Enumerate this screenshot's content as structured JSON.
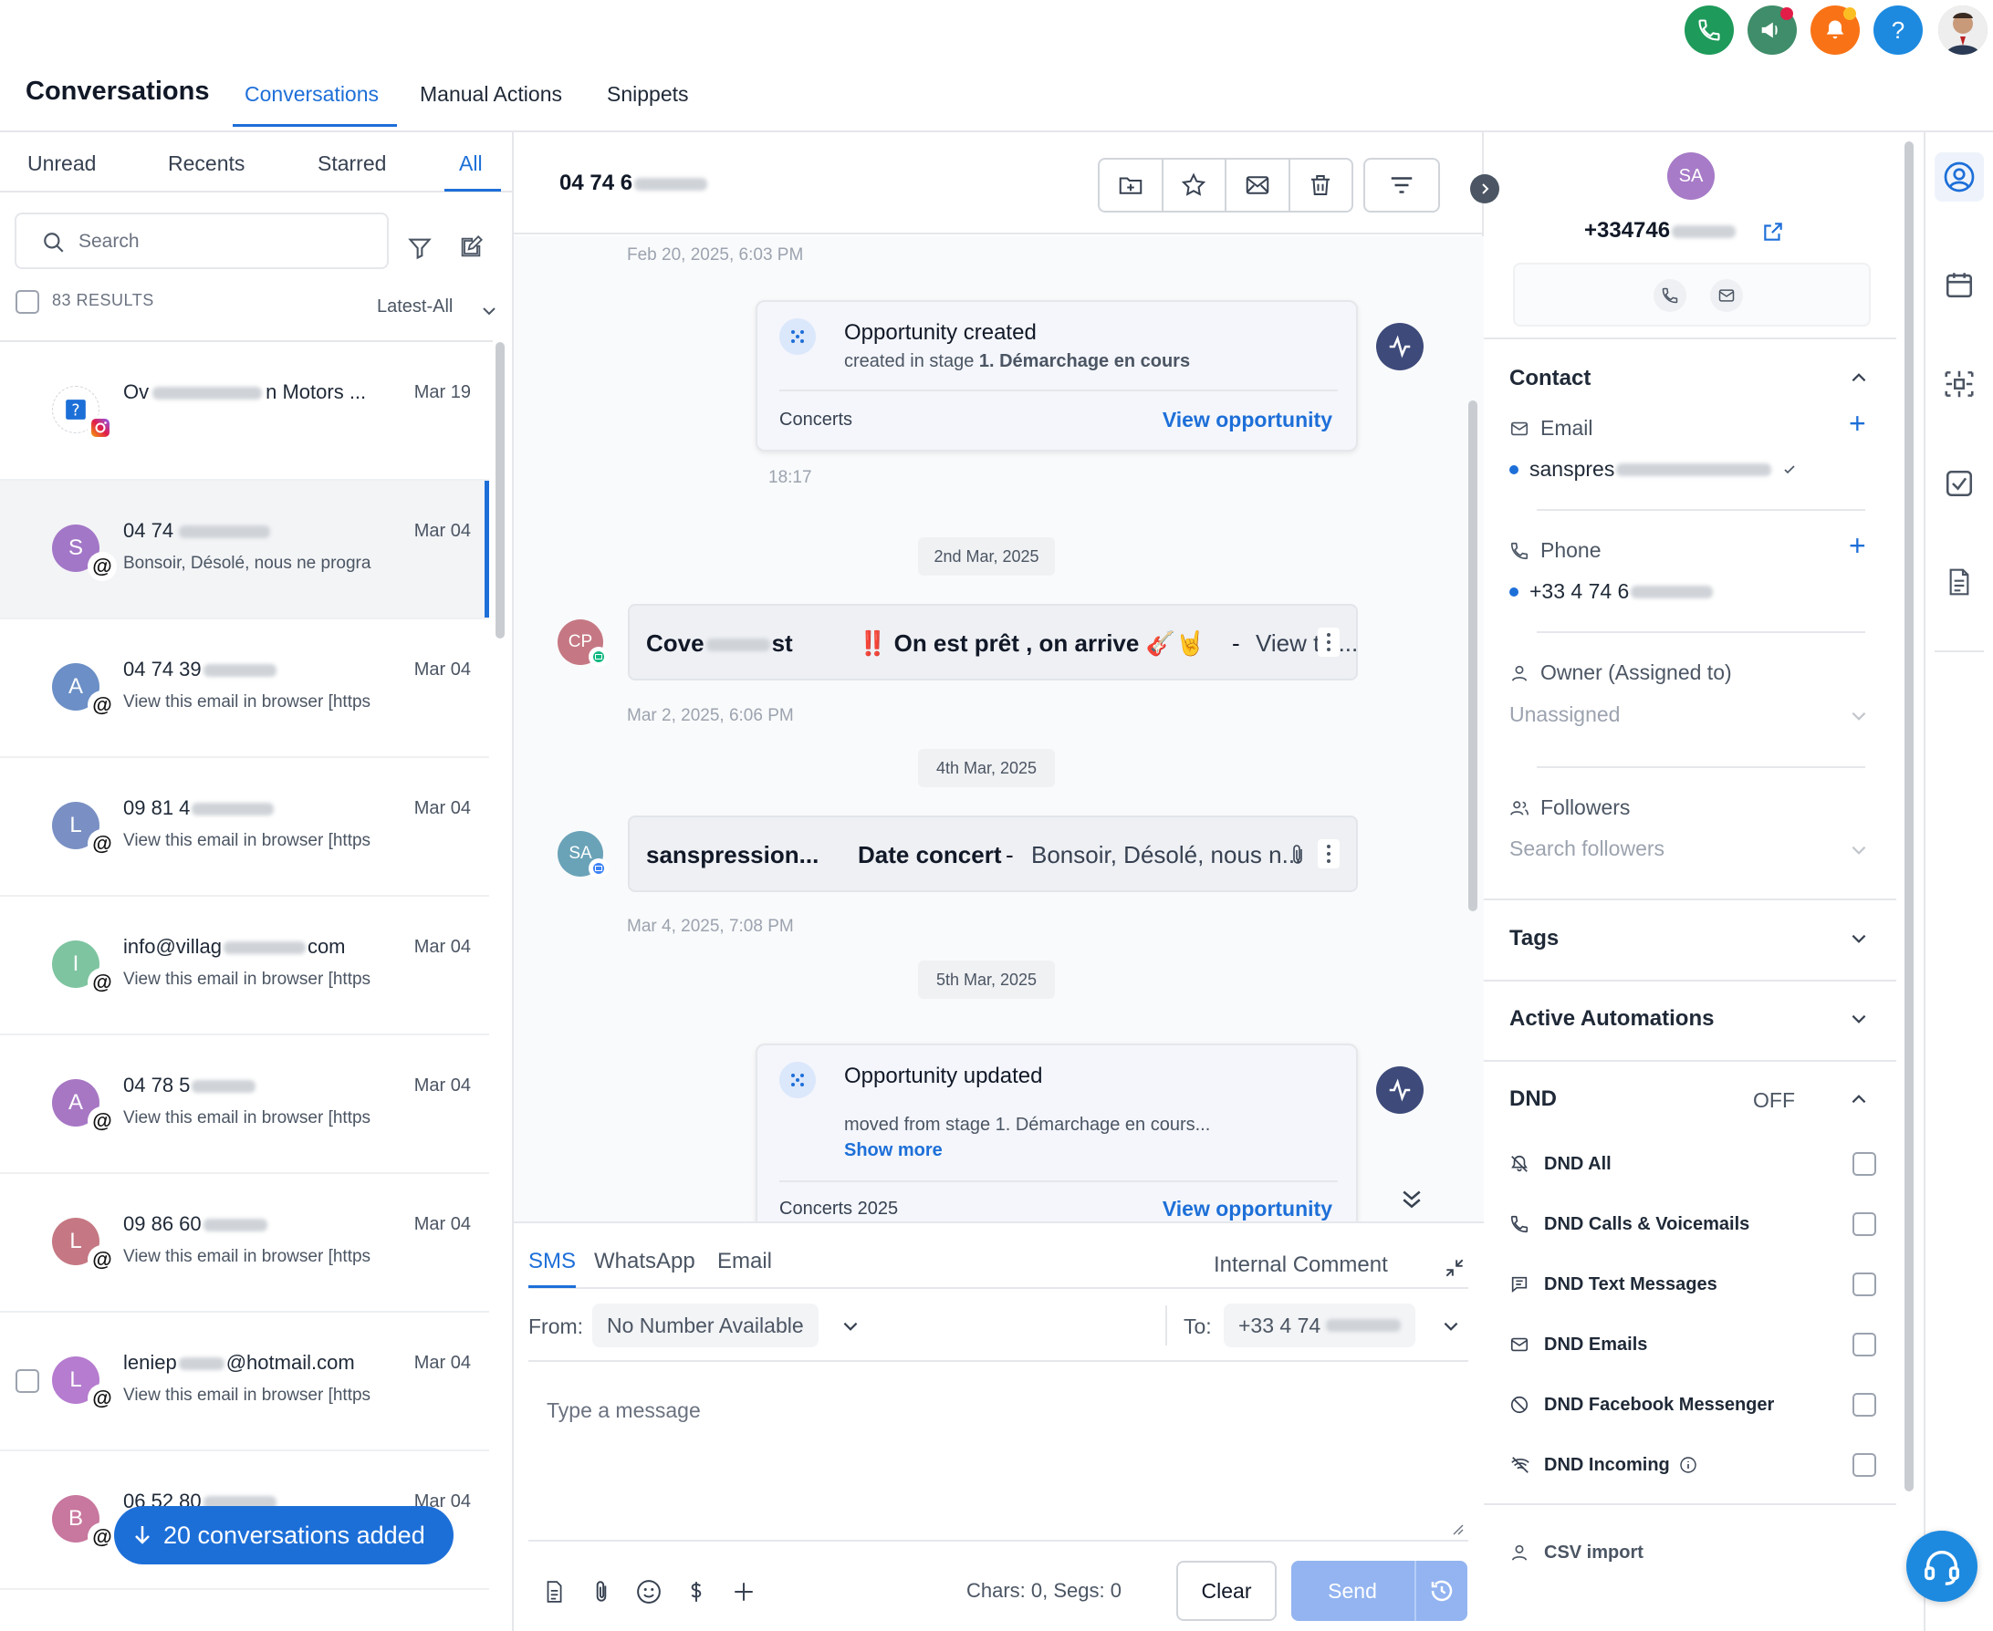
{
  "topbar": {
    "page_title": "Conversations",
    "tabs": [
      {
        "label": "Conversations",
        "active": true
      },
      {
        "label": "Manual Actions",
        "active": false
      },
      {
        "label": "Snippets",
        "active": false
      }
    ],
    "icons": [
      "phone-icon",
      "megaphone-icon",
      "bell-icon",
      "help-icon",
      "user-avatar"
    ],
    "help_label": "?"
  },
  "left": {
    "filter_tabs": [
      {
        "label": "Unread"
      },
      {
        "label": "Recents"
      },
      {
        "label": "Starred"
      },
      {
        "label": "All",
        "active": true
      }
    ],
    "search_placeholder": "Search",
    "results_label": "83 RESULTS",
    "sort_label": "Latest-All",
    "conversations": [
      {
        "name_start": "Ov",
        "name_end": "n Motors ...",
        "date": "Mar 19",
        "preview": "",
        "avatar": "",
        "color": "#ffffff"
      },
      {
        "name_start": "04 74",
        "name_end": "",
        "date": "Mar 04",
        "preview": "Bonsoir, Désolé, nous ne progra",
        "avatar": "S",
        "color": "#a377c7",
        "selected": true
      },
      {
        "name_start": "04 74 39",
        "name_end": "",
        "date": "Mar 04",
        "preview": "View this email in browser [https",
        "avatar": "A",
        "color": "#6b8fc6"
      },
      {
        "name_start": "09 81 4",
        "name_end": "",
        "date": "Mar 04",
        "preview": "View this email in browser [https",
        "avatar": "L",
        "color": "#7a90c4"
      },
      {
        "name_start": "info@villag",
        "name_end": "com",
        "date": "Mar 04",
        "preview": "View this email in browser [https",
        "avatar": "I",
        "color": "#7ec4a0"
      },
      {
        "name_start": "04 78 5",
        "name_end": "",
        "date": "Mar 04",
        "preview": "View this email in browser [https",
        "avatar": "A",
        "color": "#a777c4"
      },
      {
        "name_start": "09 86 60",
        "name_end": "",
        "date": "Mar 04",
        "preview": "View this email in browser [https",
        "avatar": "L",
        "color": "#c57883"
      },
      {
        "name_start": "leniep",
        "name_end": "@hotmail.com",
        "date": "Mar 04",
        "preview": "View this email in browser [https",
        "avatar": "L",
        "color": "#b57ccf"
      },
      {
        "name_start": "06 52 80",
        "name_end": "",
        "date": "Mar 04",
        "preview": "",
        "avatar": "B",
        "color": "#c8779e"
      }
    ],
    "toast": "20 conversations added"
  },
  "center": {
    "title": "04 74 6",
    "thread": {
      "ts1": "Feb 20, 2025, 6:03 PM",
      "opp1": {
        "title": "Opportunity created",
        "sub_prefix": "created in stage ",
        "sub_stage": "1. Démarchage en cours",
        "pipeline": "Concerts",
        "link": "View opportunity"
      },
      "time1": "18:17",
      "date1": "2nd Mar, 2025",
      "msg1": {
        "avatar": "CP",
        "from_start": "Cove",
        "from_end": "st",
        "subject": "‼️ On est prêt , on arrive 🎸🤘",
        "sep": "-",
        "snippet": "View thi..."
      },
      "ts2": "Mar 2, 2025, 6:06 PM",
      "date2": "4th Mar, 2025",
      "msg2": {
        "avatar": "SA",
        "from": "sanspression...",
        "subject": "Date concert",
        "sep": "-",
        "snippet": "Bonsoir, Désolé, nous n..."
      },
      "ts3": "Mar 4, 2025, 7:08 PM",
      "date3": "5th Mar, 2025",
      "opp2": {
        "title": "Opportunity updated",
        "sub": "moved from stage 1. Démarchage en cours...",
        "more": "Show more",
        "pipeline": "Concerts 2025",
        "link": "View opportunity"
      }
    },
    "composer": {
      "tabs": [
        {
          "label": "SMS",
          "active": true
        },
        {
          "label": "WhatsApp"
        },
        {
          "label": "Email"
        }
      ],
      "internal_comment": "Internal Comment",
      "from_label": "From:",
      "from_value": "No Number Available",
      "to_label": "To:",
      "to_value": "+33 4 74",
      "placeholder": "Type a message",
      "chars": "Chars: 0, Segs: 0",
      "clear": "Clear",
      "send": "Send"
    }
  },
  "right": {
    "avatar": "SA",
    "phone": "+334746",
    "contact": {
      "heading": "Contact",
      "email_label": "Email",
      "email_value": "sanspres",
      "phone_label": "Phone",
      "phone_value": "+33 4 74 6",
      "owner_label": "Owner (Assigned to)",
      "owner_value": "Unassigned",
      "followers_label": "Followers",
      "followers_placeholder": "Search followers"
    },
    "tags": "Tags",
    "automations": "Active Automations",
    "dnd": {
      "heading": "DND",
      "status": "OFF",
      "items": [
        "DND All",
        "DND Calls & Voicemails",
        "DND Text Messages",
        "DND Emails",
        "DND Facebook Messenger",
        "DND Incoming"
      ]
    },
    "csv": "CSV import"
  },
  "colors": {
    "accent": "#1d6fd8",
    "green": "#1e9a5a",
    "orange": "#f97316",
    "activity": "#3d4a7a"
  }
}
